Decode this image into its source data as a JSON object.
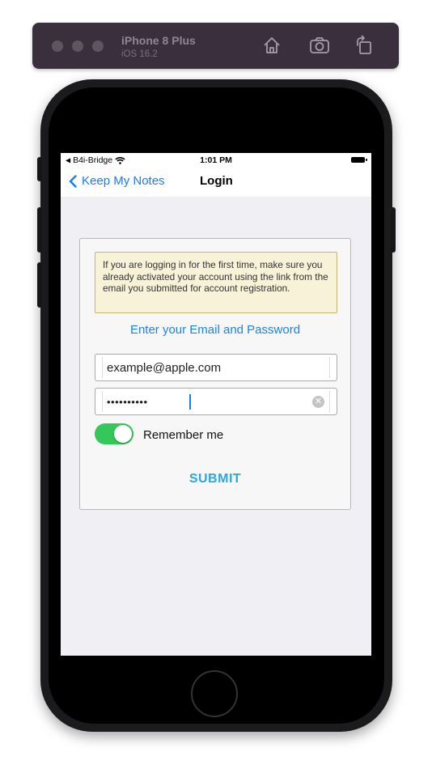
{
  "simulator": {
    "device_name": "iPhone 8 Plus",
    "os_version": "iOS 16.2",
    "buttons": [
      "home-icon",
      "screenshot-icon",
      "rotate-icon"
    ]
  },
  "status_bar": {
    "carrier": "B4i-Bridge",
    "time": "1:01 PM"
  },
  "nav": {
    "back_label": "Keep My Notes",
    "title": "Login"
  },
  "login": {
    "notice": "If you are logging in for the first time, make sure you already activated your account using the link from the email you submitted for account registration.",
    "heading": "Enter your Email and Password",
    "email_value": "example@apple.com",
    "password_value": "••••••••••",
    "remember_label": "Remember me",
    "remember_on": true,
    "submit_label": "SUBMIT"
  },
  "colors": {
    "accent": "#1a7bf5",
    "toggle_on": "#34c759",
    "submit": "#2aa8e0",
    "notice_bg": "#f8f2d8"
  }
}
